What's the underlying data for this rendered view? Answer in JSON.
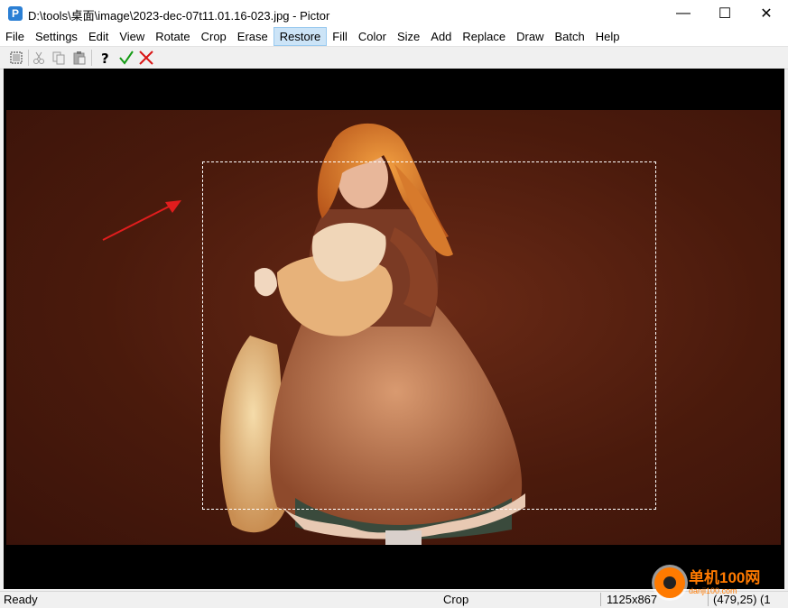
{
  "window": {
    "title": "D:\\tools\\桌面\\image\\2023-dec-07t11.01.16-023.jpg - Pictor",
    "app_icon_letter": "P",
    "minimize": "—",
    "maximize": "☐",
    "close": "✕"
  },
  "menu": {
    "items": [
      "File",
      "Settings",
      "Edit",
      "View",
      "Rotate",
      "Crop",
      "Erase",
      "Restore",
      "Fill",
      "Color",
      "Size",
      "Add",
      "Replace",
      "Draw",
      "Batch",
      "Help"
    ],
    "active": "Restore"
  },
  "toolbar": {
    "buttons": [
      "select-all",
      "cut",
      "copy",
      "paste",
      "help",
      "apply",
      "cancel"
    ]
  },
  "status": {
    "left": "Ready",
    "mode": "Crop",
    "dimensions": "1125x867",
    "coords": "(479,25) (1"
  },
  "watermark": {
    "text": "单机100网",
    "sub": "danji100.com"
  },
  "colors": {
    "accent_menu": "#cce4f7",
    "canvas_bg": "#000000",
    "photo_bg": "#4a1a0c",
    "arrow": "#e11d1d",
    "watermark": "#ff7a00"
  }
}
